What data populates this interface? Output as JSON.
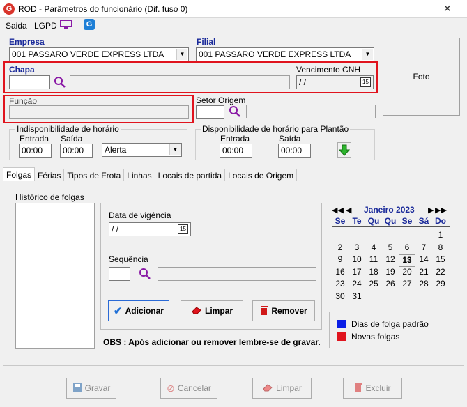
{
  "window": {
    "title": "ROD - Parâmetros do funcionário (Dif. fuso 0)",
    "close_glyph": "✕"
  },
  "menu": {
    "items": [
      "Saida",
      "LGPD"
    ]
  },
  "empresa": {
    "label": "Empresa",
    "value": "001 PASSARO VERDE EXPRESS LTDA"
  },
  "filial": {
    "label": "Filial",
    "value": "001 PASSARO VERDE EXPRESS LTDA"
  },
  "chapa": {
    "label": "Chapa",
    "value": ""
  },
  "vencimento": {
    "label": "Vencimento CNH",
    "value": " / /"
  },
  "funcao": {
    "label": "Função",
    "value": ""
  },
  "setor": {
    "label": "Setor Origem",
    "value": "",
    "desc": ""
  },
  "foto": {
    "label": "Foto"
  },
  "indisp": {
    "title": "Indisponibilidade de horário",
    "entrada_label": "Entrada",
    "entrada": "00:00",
    "saida_label": "Saída",
    "saida": "00:00",
    "alerta": "Alerta"
  },
  "disp": {
    "title": "Disponibilidade de horário para Plantão",
    "entrada_label": "Entrada",
    "entrada": "00:00",
    "saida_label": "Saída",
    "saida": "00:00"
  },
  "tabs": [
    "Folgas",
    "Férias",
    "Tipos de Frota",
    "Linhas",
    "Locais de partida",
    "Locais de Origem"
  ],
  "folgas": {
    "historico_label": "Histórico de folgas",
    "data_vigencia_label": "Data de vigência",
    "data_vigencia": " / /",
    "sequencia_label": "Sequência",
    "btn_adicionar": "Adicionar",
    "btn_limpar": "Limpar",
    "btn_remover": "Remover",
    "obs": "OBS : Após adicionar ou remover lembre-se de gravar."
  },
  "calendar": {
    "month": "Janeiro 2023",
    "weekdays": [
      "Se",
      "Te",
      "Qu",
      "Qu",
      "Se",
      "Sá",
      "Do"
    ],
    "rows": [
      [
        "",
        "",
        "",
        "",
        "",
        "",
        "1"
      ],
      [
        "2",
        "3",
        "4",
        "5",
        "6",
        "7",
        "8"
      ],
      [
        "9",
        "10",
        "11",
        "12",
        "13",
        "14",
        "15"
      ],
      [
        "16",
        "17",
        "18",
        "19",
        "20",
        "21",
        "22"
      ],
      [
        "23",
        "24",
        "25",
        "26",
        "27",
        "28",
        "29"
      ],
      [
        "30",
        "31",
        "",
        "",
        "",
        "",
        ""
      ]
    ],
    "today": "13"
  },
  "legend": {
    "padrao": "Dias de folga padrão",
    "padrao_color": "#0a1ee6",
    "novas": "Novas folgas",
    "novas_color": "#e0141e"
  },
  "footer": {
    "gravar": "Gravar",
    "cancelar": "Cancelar",
    "limpar": "Limpar",
    "excluir": "Excluir"
  }
}
